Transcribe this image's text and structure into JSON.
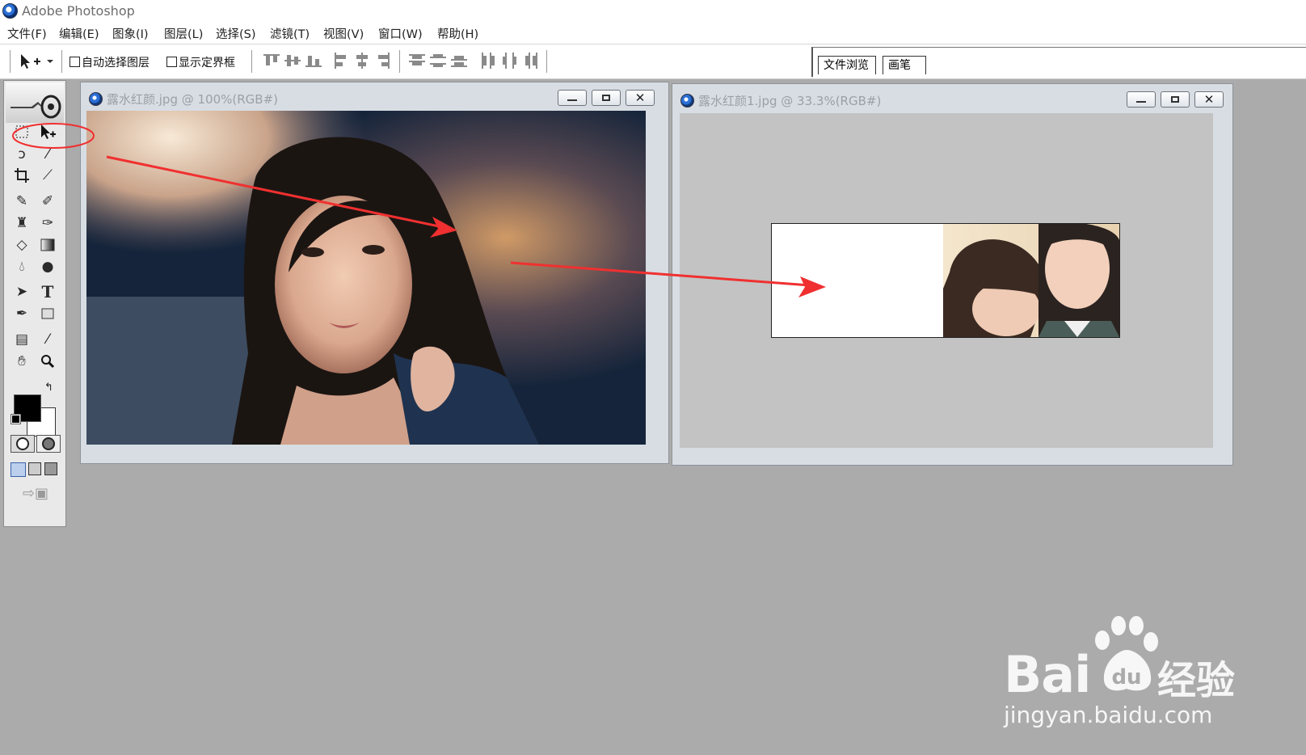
{
  "app": {
    "title": "Adobe Photoshop"
  },
  "menu": {
    "items": [
      "文件(F)",
      "编辑(E)",
      "图象(I)",
      "图层(L)",
      "选择(S)",
      "滤镜(T)",
      "视图(V)",
      "窗口(W)",
      "帮助(H)"
    ]
  },
  "options_bar": {
    "auto_select_layer": "自动选择图层",
    "show_bounding_box": "显示定界框"
  },
  "palette_well": {
    "tabs": [
      "文件浏览",
      "画笔"
    ]
  },
  "documents": [
    {
      "title": "露水红颜.jpg @ 100%(RGB#)"
    },
    {
      "title": "露水红颜1.jpg @ 33.3%(RGB#)"
    }
  ],
  "icons": {
    "tools": [
      "marquee-icon",
      "move-icon",
      "lasso-icon",
      "magic-wand-icon",
      "crop-icon",
      "slice-icon",
      "healing-brush-icon",
      "brush-icon",
      "clone-stamp-icon",
      "history-brush-icon",
      "eraser-icon",
      "gradient-icon",
      "blur-icon",
      "dodge-icon",
      "path-selection-icon",
      "type-icon",
      "pen-icon",
      "shape-icon",
      "notes-icon",
      "eyedropper-icon",
      "hand-icon",
      "zoom-icon"
    ]
  },
  "colors": {
    "annotation_red": "#f03030",
    "foreground": "#000000",
    "background": "#ffffff"
  },
  "watermark": {
    "brand": "Bai",
    "brand_cn": "经验",
    "url": "jingyan.baidu.com"
  }
}
